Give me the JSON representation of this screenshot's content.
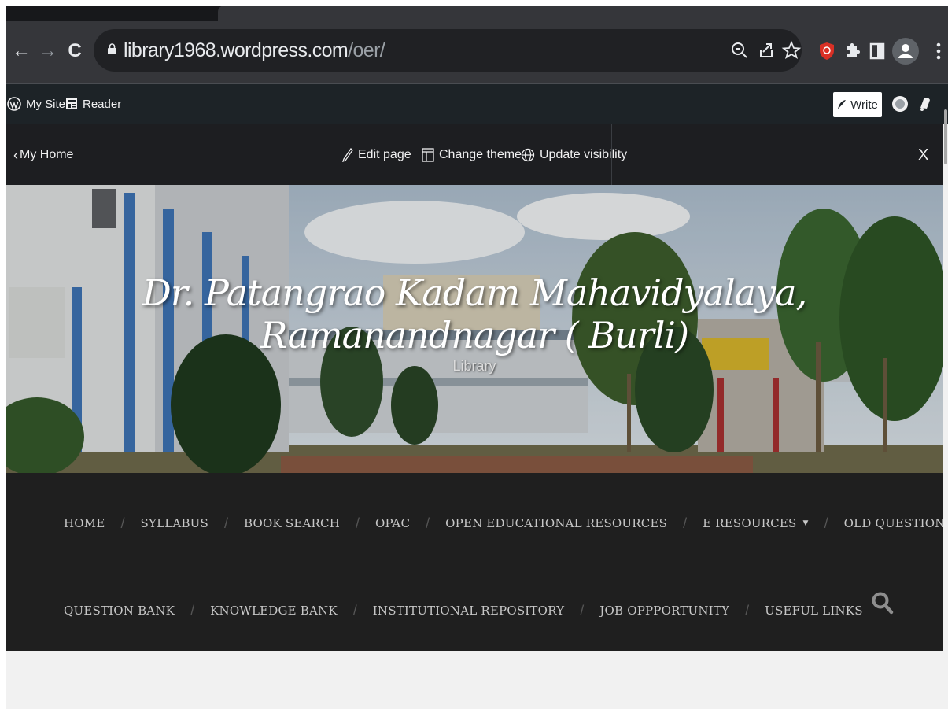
{
  "browser": {
    "url_host": "library1968.wordpress.com",
    "url_path": "/oer/",
    "back_glyph": "←",
    "forward_glyph": "→",
    "reload_glyph": "C"
  },
  "admin_bar": {
    "my_site": "My Site",
    "reader": "Reader",
    "write": "Write"
  },
  "page_toolbar": {
    "back": "My Home",
    "edit_page": "Edit page",
    "change_theme": "Change theme",
    "update_visibility": "Update visibility",
    "close": "X"
  },
  "site": {
    "title": "Dr. Patangrao Kadam Mahavidyalaya, Ramanandnagar ( Burli)",
    "tagline": "Library"
  },
  "menu": {
    "row1": [
      "HOME",
      "SYLLABUS",
      "BOOK SEARCH",
      "OPAC",
      "OPEN EDUCATIONAL RESOURCES",
      "E RESOURCES",
      "OLD QUESTION PAPER"
    ],
    "row2": [
      "QUESTION BANK",
      "KNOWLEDGE BANK",
      "INSTITUTIONAL REPOSITORY",
      "JOB OPPPORTUNITY",
      "USEFUL LINKS"
    ],
    "dropdown_glyph": "▼"
  },
  "colors": {
    "chrome_toolbar": "#35363a",
    "admin_bar": "#1d2327",
    "menu_bg": "#1f1f1f",
    "menu_text": "#c7c7c7",
    "extension_red": "#d93025"
  }
}
